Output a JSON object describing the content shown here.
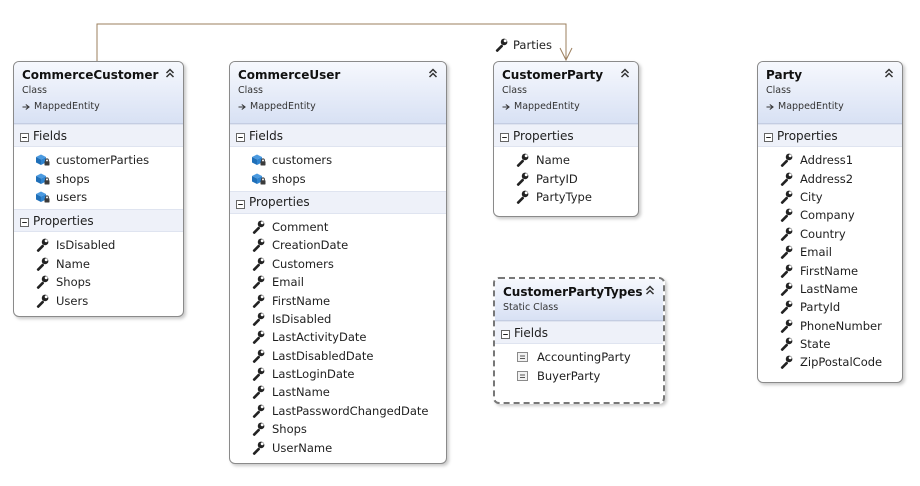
{
  "association": {
    "label": "Parties",
    "line_color": "#9b7f5e"
  },
  "colors": {
    "header_top": "#f6f8fd",
    "header_bottom": "#d8e1f4",
    "section_bg": "#eef1f9",
    "border": "#8a8a8a",
    "field_icon": "#2f7fc9",
    "property_icon": "#222222",
    "enum_icon": "#888888"
  },
  "classes": [
    {
      "id": "commerce-customer",
      "title": "CommerceCustomer",
      "kind": "Class",
      "base": "MappedEntity",
      "sections": [
        {
          "name": "Fields",
          "type": "field",
          "items": [
            "customerParties",
            "shops",
            "users"
          ]
        },
        {
          "name": "Properties",
          "type": "property",
          "items": [
            "IsDisabled",
            "Name",
            "Shops",
            "Users"
          ]
        }
      ]
    },
    {
      "id": "commerce-user",
      "title": "CommerceUser",
      "kind": "Class",
      "base": "MappedEntity",
      "sections": [
        {
          "name": "Fields",
          "type": "field",
          "items": [
            "customers",
            "shops"
          ]
        },
        {
          "name": "Properties",
          "type": "property",
          "items": [
            "Comment",
            "CreationDate",
            "Customers",
            "Email",
            "FirstName",
            "IsDisabled",
            "LastActivityDate",
            "LastDisabledDate",
            "LastLoginDate",
            "LastName",
            "LastPasswordChangedDate",
            "Shops",
            "UserName"
          ]
        }
      ]
    },
    {
      "id": "customer-party",
      "title": "CustomerParty",
      "kind": "Class",
      "base": "MappedEntity",
      "sections": [
        {
          "name": "Properties",
          "type": "property",
          "items": [
            "Name",
            "PartyID",
            "PartyType"
          ]
        }
      ]
    },
    {
      "id": "customer-party-types",
      "title": "CustomerPartyTypes",
      "kind": "Static Class",
      "static": true,
      "sections": [
        {
          "name": "Fields",
          "type": "enum",
          "items": [
            "AccountingParty",
            "BuyerParty"
          ]
        }
      ]
    },
    {
      "id": "party",
      "title": "Party",
      "kind": "Class",
      "base": "MappedEntity",
      "sections": [
        {
          "name": "Properties",
          "type": "property",
          "items": [
            "Address1",
            "Address2",
            "City",
            "Company",
            "Country",
            "Email",
            "FirstName",
            "LastName",
            "PartyId",
            "PhoneNumber",
            "State",
            "ZipPostalCode"
          ]
        }
      ]
    }
  ]
}
